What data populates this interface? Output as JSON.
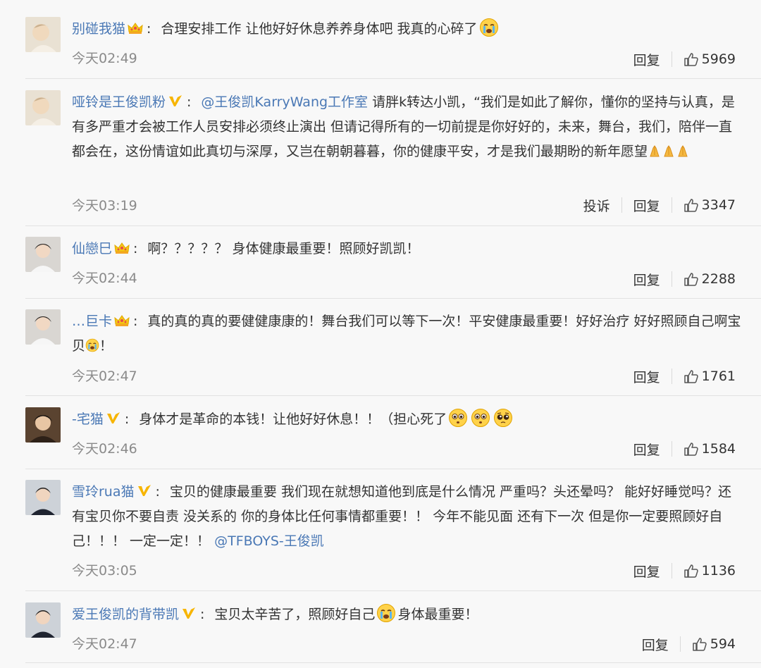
{
  "colors": {
    "link": "#4a78b5",
    "time": "#8a8a8a",
    "text": "#333333",
    "background": "#f8f8f8"
  },
  "comments": [
    {
      "username": "别碰我猫",
      "badge": "crown-icon",
      "text": "合理安排工作 让他好好休息养养身体吧 我真的心碎了",
      "emoji_end": "crying-emoji",
      "time": "今天02:49",
      "reply": "回复",
      "likes": "5969"
    },
    {
      "username": "哑铃是王俊凯粉",
      "badge": "verified-v-icon",
      "mention": "@王俊凯KarryWang工作室",
      "text": " 请胖k转达小凯，“我们是如此了解你，懂你的坚持与认真，是有多严重才会被工作人员安排必须终止演出 但请记得所有的一切前提是你好好的，未来，舞台，我们，陪伴一直都会在，这份情谊如此真切与深厚，又岂在朝朝暮暮，你的健康平安，才是我们最期盼的新年愿望",
      "emoji_end": "pray-emoji",
      "time": "今天03:19",
      "report": "投诉",
      "reply": "回复",
      "likes": "3347"
    },
    {
      "username": "仙戀巳",
      "badge": "crown-icon",
      "text": "啊？？？？？ 身体健康最重要！照顾好凯凯！",
      "time": "今天02:44",
      "reply": "回复",
      "likes": "2288"
    },
    {
      "username": "…巨卡",
      "badge": "crown-icon",
      "text": "真的真的真的要健健康康的！舞台我们可以等下一次！平安健康最重要！好好治疗 好好照顾自己啊宝贝",
      "text_end": "！",
      "emoji_end": "crying-emoji",
      "time": "今天02:47",
      "reply": "回复",
      "likes": "1761"
    },
    {
      "username": "-宅猫",
      "badge": "verified-v-icon",
      "text": "身体才是革命的本钱！让他好好休息！！（担心死了",
      "emoji_end": "worried-emoji",
      "time": "今天02:46",
      "reply": "回复",
      "likes": "1584"
    },
    {
      "username": "雪玲rua猫",
      "badge": "verified-v-icon",
      "text": "宝贝的健康最重要 我们现在就想知道他到底是什么情况 严重吗？头还晕吗？ 能好好睡觉吗？还有宝贝你不要自责 没关系的 你的身体比任何事情都重要！！ 今年不能见面 还有下一次 但是你一定要照顾好自己！！！ 一定一定！！",
      "mention_end": "@TFBOYS-王俊凯",
      "time": "今天03:05",
      "reply": "回复",
      "likes": "1136"
    },
    {
      "username": "爱王俊凯的背带凯",
      "badge": "verified-v-icon",
      "text": "宝贝太辛苦了，照顾好自己",
      "text_after": "身体最重要！",
      "emoji_mid": "crying-emoji",
      "time": "今天02:47",
      "reply": "回复",
      "likes": "594"
    }
  ]
}
